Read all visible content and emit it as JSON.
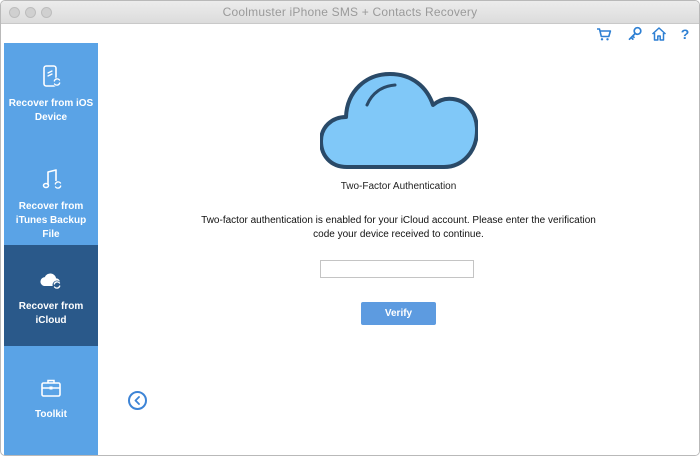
{
  "window": {
    "title": "Coolmuster iPhone SMS + Contacts Recovery"
  },
  "toolbar": {
    "icons": [
      "cart-icon",
      "key-icon",
      "home-icon",
      "help-icon"
    ],
    "help_glyph": "?"
  },
  "sidebar": {
    "items": [
      {
        "label": "Recover from iOS Device",
        "icon": "phone-sync-icon",
        "active": false
      },
      {
        "label": "Recover from iTunes Backup File",
        "icon": "music-sync-icon",
        "active": false
      },
      {
        "label": "Recover from iCloud",
        "icon": "cloud-sync-icon",
        "active": true
      },
      {
        "label": "Toolkit",
        "icon": "toolbox-icon",
        "active": false
      }
    ]
  },
  "main": {
    "heading": "Two-Factor Authentication",
    "message": "Two-factor authentication is enabled for your iCloud account. Please enter the verification code your device received to continue.",
    "code_value": "",
    "code_placeholder": "",
    "verify_label": "Verify"
  },
  "colors": {
    "sidebar": "#5aa3e6",
    "sidebar_active": "#2a598a",
    "accent": "#5d9be0",
    "cloud_fill": "#80c8f8",
    "cloud_stroke": "#2a4a68"
  }
}
